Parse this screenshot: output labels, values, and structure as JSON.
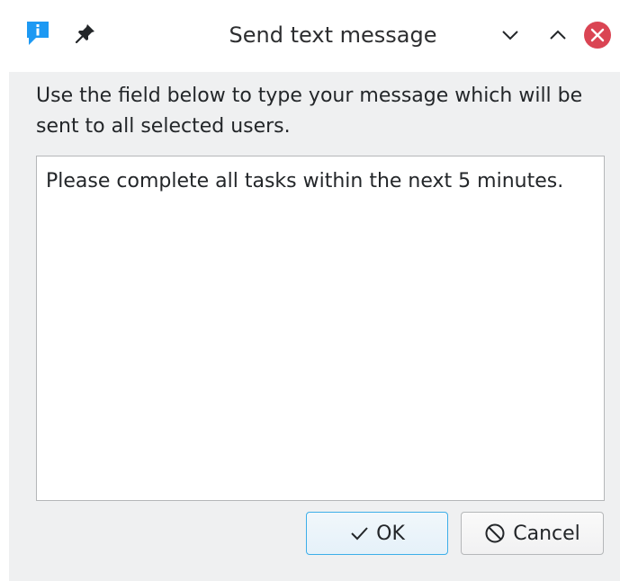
{
  "window": {
    "title": "Send text message"
  },
  "icons": {
    "app": "message-info-icon",
    "pin": "pin-icon",
    "minimize": "chevron-down-icon",
    "maximize": "chevron-up-icon",
    "close": "close-icon",
    "ok": "checkmark-icon",
    "cancel": "cancel-icon"
  },
  "dialog": {
    "instructions": "Use the field below to type your message which will be sent to all selected users.",
    "message": "Please complete all tasks within the next 5 minutes.",
    "ok_label": "OK",
    "cancel_label": "Cancel"
  },
  "colors": {
    "accent": "#3daee9",
    "close_button": "#da4453",
    "app_icon": "#1d99f3"
  }
}
